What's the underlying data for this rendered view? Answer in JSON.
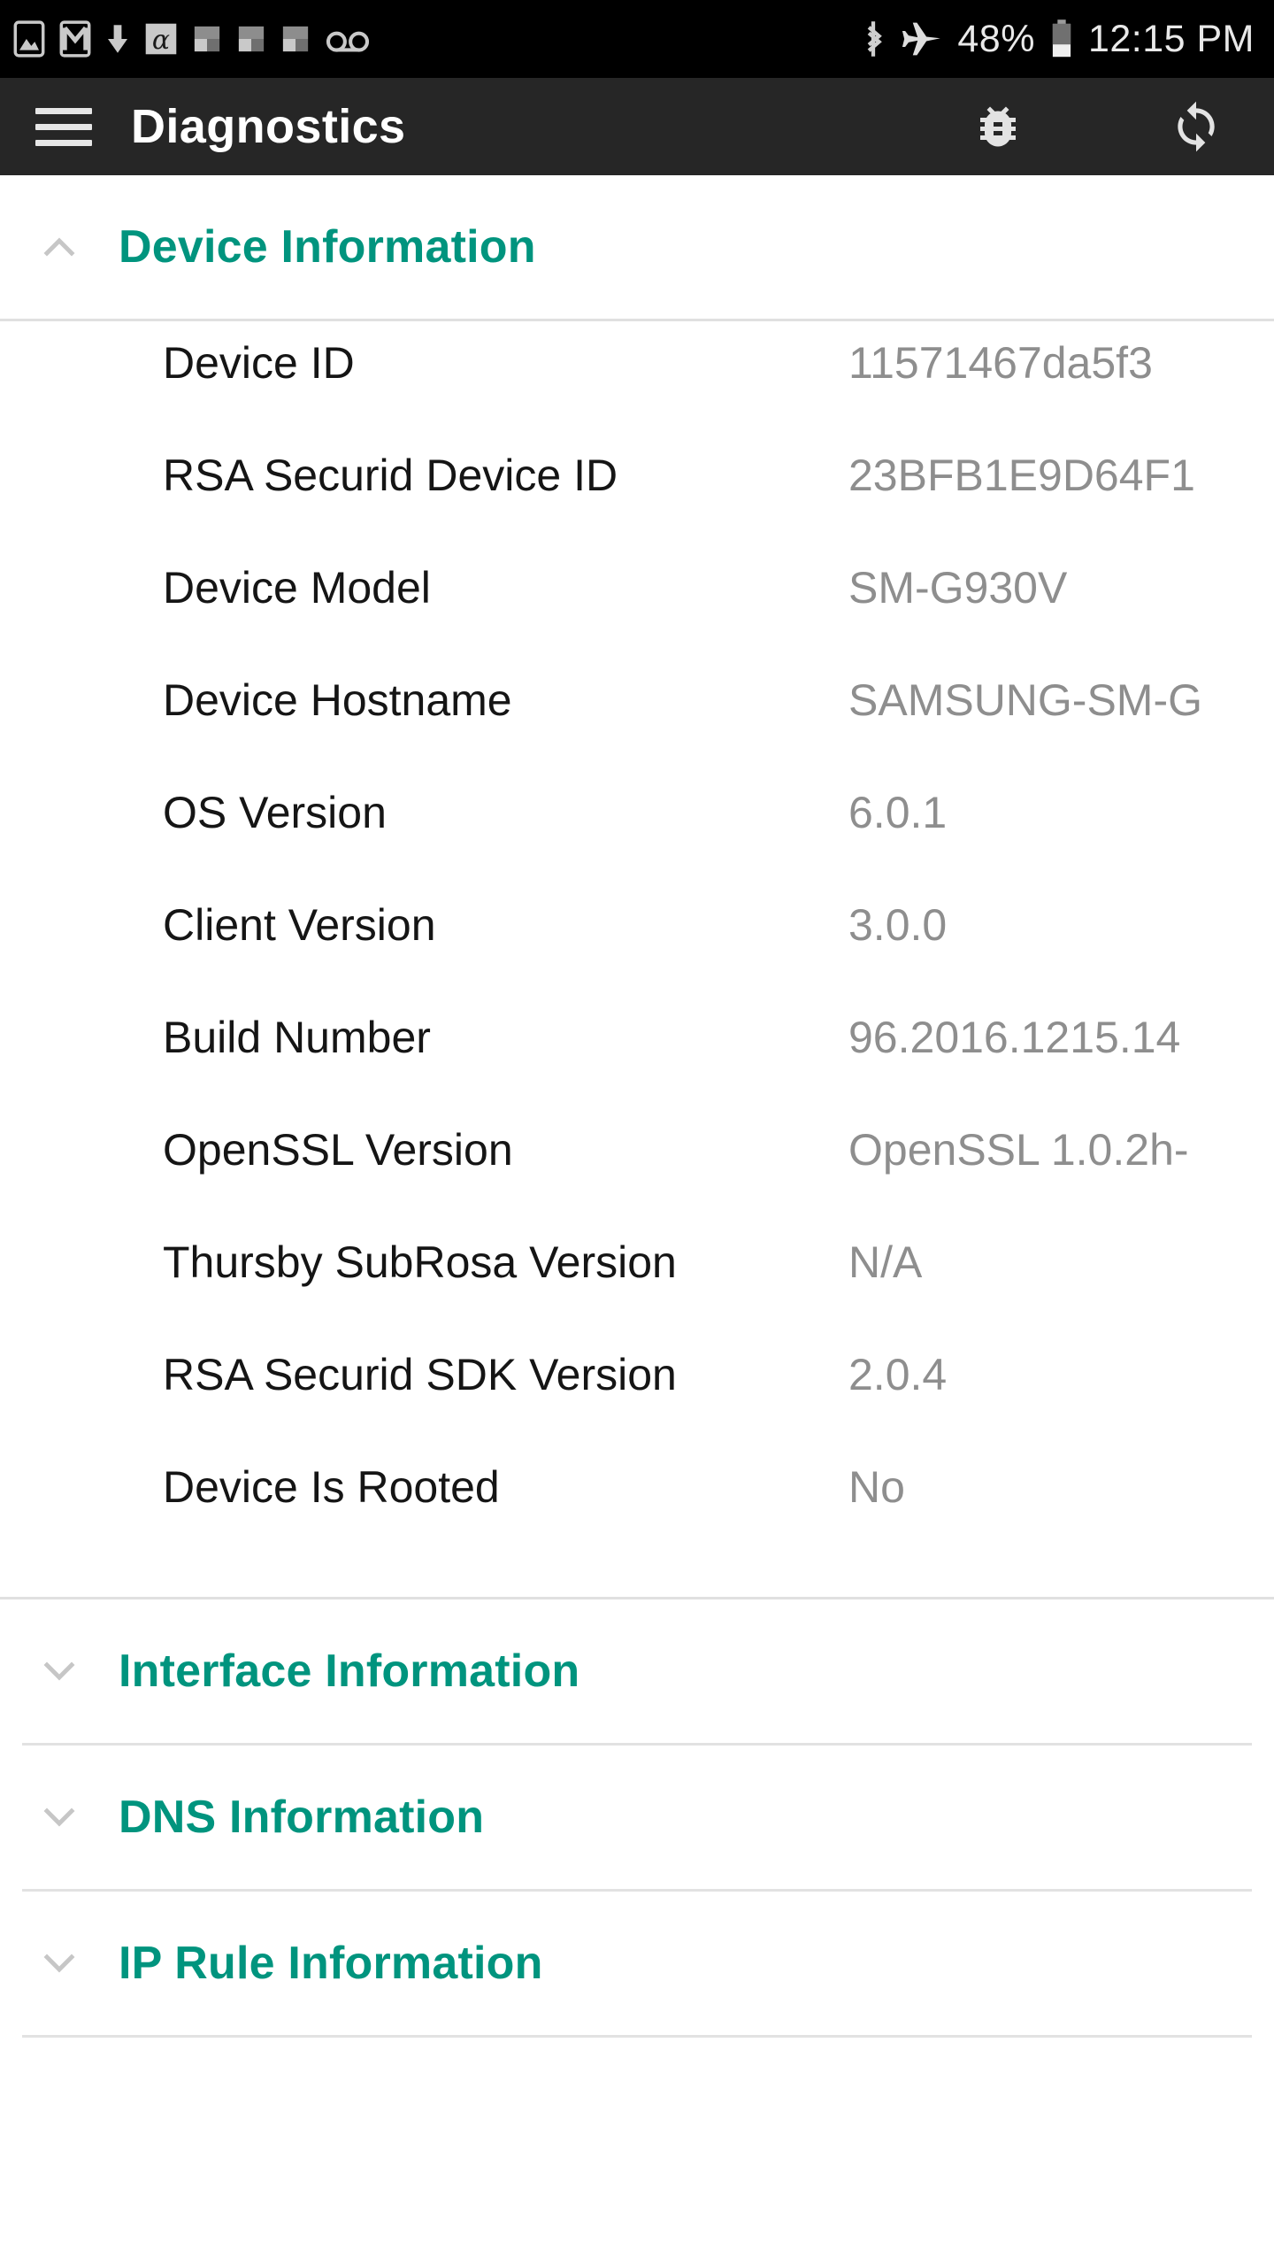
{
  "statusbar": {
    "left_icons": [
      {
        "name": "photo-icon",
        "glyph": "photo"
      },
      {
        "name": "gmail-icon",
        "glyph": "mail"
      },
      {
        "name": "download-icon",
        "glyph": "download"
      },
      {
        "name": "alpha-app-icon",
        "glyph": "alpha"
      },
      {
        "name": "app-notification-icon-1",
        "glyph": "flag"
      },
      {
        "name": "app-notification-icon-2",
        "glyph": "flag"
      },
      {
        "name": "app-notification-icon-3",
        "glyph": "flag"
      },
      {
        "name": "voicemail-icon",
        "glyph": "voicemail"
      }
    ],
    "bluetooth_icon": "bluetooth-icon",
    "airplane_icon": "airplane-mode-icon",
    "battery_percent": "48%",
    "battery_icon": "battery-icon",
    "clock": "12:15 PM"
  },
  "appbar": {
    "menu_icon": "hamburger-menu-icon",
    "title": "Diagnostics",
    "actions": [
      {
        "name": "debug-bug-button",
        "icon": "bug-icon"
      },
      {
        "name": "refresh-button",
        "icon": "refresh-icon"
      }
    ]
  },
  "colors": {
    "accent_teal": "#00947E",
    "appbar_bg": "#262626",
    "statusbar_bg": "#000000",
    "label_text": "#151515",
    "value_text": "#8e8e8e",
    "divider": "#e0e0e0"
  },
  "sections": [
    {
      "id": "device-information",
      "title": "Device Information",
      "expanded": true,
      "chevron": "chevron-up-icon",
      "rows": [
        {
          "label": "Device ID",
          "value": "11571467da5f3"
        },
        {
          "label": "RSA Securid Device ID",
          "value": "23BFB1E9D64F1"
        },
        {
          "label": "Device Model",
          "value": "SM-G930V"
        },
        {
          "label": "Device Hostname",
          "value": "SAMSUNG-SM-G"
        },
        {
          "label": "OS Version",
          "value": "6.0.1"
        },
        {
          "label": "Client Version",
          "value": "3.0.0"
        },
        {
          "label": "Build Number",
          "value": "96.2016.1215.14"
        },
        {
          "label": "OpenSSL Version",
          "value": "OpenSSL 1.0.2h-"
        },
        {
          "label": "Thursby SubRosa Version",
          "value": "N/A"
        },
        {
          "label": "RSA Securid SDK Version",
          "value": "2.0.4"
        },
        {
          "label": "Device Is Rooted",
          "value": "No"
        }
      ]
    },
    {
      "id": "interface-information",
      "title": "Interface Information",
      "expanded": false,
      "chevron": "chevron-down-icon",
      "rows": []
    },
    {
      "id": "dns-information",
      "title": "DNS Information",
      "expanded": false,
      "chevron": "chevron-down-icon",
      "rows": []
    },
    {
      "id": "ip-rule-information",
      "title": "IP Rule Information",
      "expanded": false,
      "chevron": "chevron-down-icon",
      "rows": []
    }
  ]
}
